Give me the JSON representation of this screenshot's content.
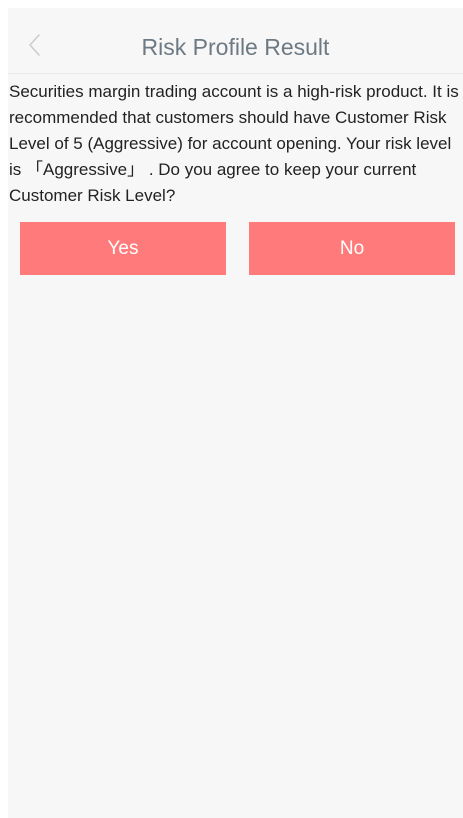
{
  "header": {
    "title": "Risk Profile Result",
    "back_icon": "chevron-left-icon"
  },
  "content": {
    "message": "Securities margin trading account is a high-risk product. It is recommended that customers should have Customer Risk Level of 5 (Aggressive) for account opening. Your risk level is 「Aggressive」 . Do you agree to keep your current Customer Risk Level?"
  },
  "actions": {
    "yes_label": "Yes",
    "no_label": "No"
  },
  "colors": {
    "button_background": "#ff7b7b",
    "button_text": "#ffffff",
    "title_text": "#6e7a83",
    "page_background": "#f7f7f7"
  }
}
